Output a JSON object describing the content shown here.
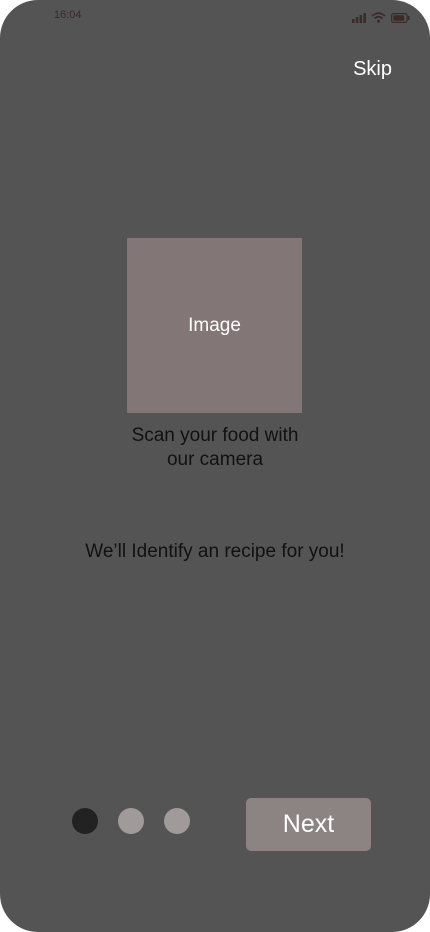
{
  "status_bar": {
    "time": "16:04",
    "icons": [
      "signal-icon",
      "wifi-icon",
      "battery-icon"
    ]
  },
  "header": {
    "skip_label": "Skip"
  },
  "main": {
    "image_placeholder": "Image",
    "headline_line1": "Scan your food with",
    "headline_line2": "our camera",
    "subtitle": "We’ll Identify an recipe for you!"
  },
  "pagination": {
    "total": 3,
    "active_index": 0
  },
  "footer": {
    "next_label": "Next"
  },
  "colors": {
    "background": "#545454",
    "image_placeholder": "#837676",
    "button": "#8c8383",
    "dot_active": "#222222",
    "dot_inactive": "#a09a9a"
  }
}
